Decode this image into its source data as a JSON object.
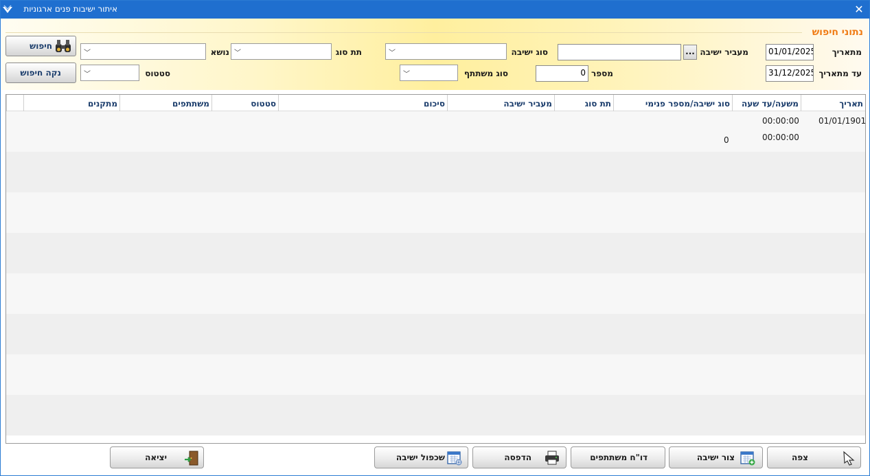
{
  "window": {
    "title": "איתור ישיבות פנים ארגוניות",
    "close_symbol": "✕"
  },
  "search_panel": {
    "title": "נתוני חיפוש",
    "from_date_label": "מתאריך",
    "from_date_value": "01/01/2025",
    "to_date_label": "עד מתאריך",
    "to_date_value": "31/12/2025",
    "meeting_host_label": "מעביר ישיבה",
    "meeting_host_value": "",
    "browse_label": "...",
    "number_label": "מספר",
    "number_value": "0",
    "meeting_type_label": "סוג ישיבה",
    "participant_type_label": "סוג משתתף",
    "subtype_label": "תת סוג",
    "subject_label": "נושא",
    "status_label": "סטטוס",
    "search_button": "חיפוש",
    "clear_button": "נקה חיפוש"
  },
  "grid": {
    "columns": [
      "תאריך",
      "משעה/עד שעה",
      "סוג ישיבה/מספר פנימי",
      "תת סוג",
      "מעביר ישיבה",
      "סיכום",
      "סטטוס",
      "משתתפים",
      "מתקנים"
    ],
    "rows": [
      {
        "date": "01/01/1901",
        "from_time": "00:00:00",
        "to_time": "00:00:00",
        "internal_number": "0"
      }
    ]
  },
  "buttons": {
    "view": "צפה",
    "attach_meeting": "צור ישיבה",
    "participants_report": "דו\"ח משתתפים",
    "print": "הדפסה",
    "duplicate_meeting": "שכפול ישיבה",
    "exit": "יציאה"
  },
  "colors": {
    "titlebar": "#1f6fcf",
    "panel_title": "#f07b14",
    "header_text": "#1a3c6b"
  },
  "icons": {
    "app": "app-logo-icon",
    "search": "binoculars-icon",
    "view": "cursor-icon",
    "attach": "calendar-add-icon",
    "print": "printer-icon",
    "duplicate": "calendar-copy-icon",
    "exit": "exit-door-icon"
  }
}
